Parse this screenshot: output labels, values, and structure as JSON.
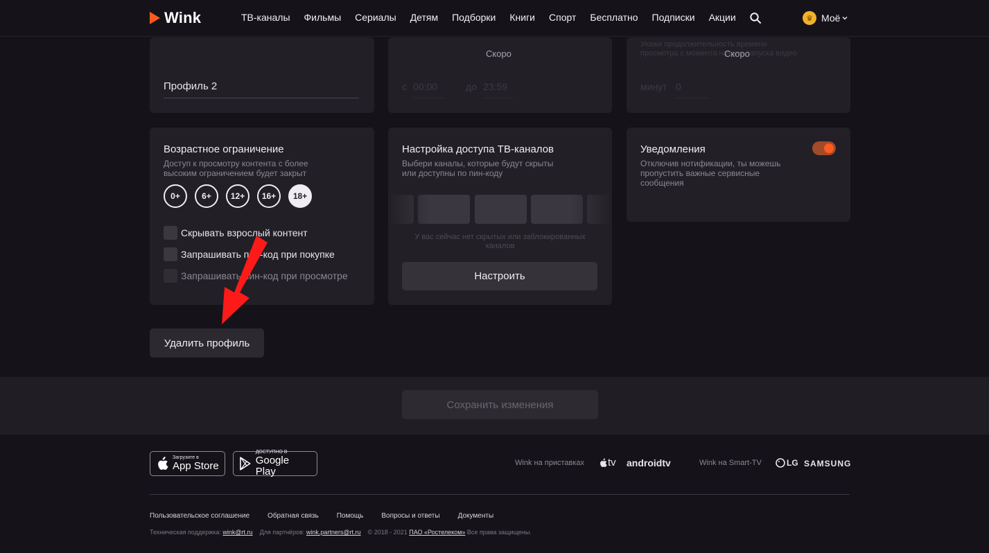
{
  "header": {
    "logo": "Wink",
    "nav": [
      "ТВ-каналы",
      "Фильмы",
      "Сериалы",
      "Детям",
      "Подборки",
      "Книги",
      "Спорт",
      "Бесплатно",
      "Подписки",
      "Акции"
    ],
    "profile_label": "Моё"
  },
  "top_cards": {
    "profile_name": "Профиль 2",
    "time_soon": "Скоро",
    "time_from_prefix": "с",
    "time_from": "00:00",
    "time_to_prefix": "до",
    "time_to": "23:59",
    "limit_desc": "Укажи продолжительность времени просмотра с момента начала запуска видео",
    "limit_soon": "Скоро",
    "limit_unit": "минут",
    "limit_value": "0"
  },
  "age_card": {
    "title": "Возрастное ограничение",
    "desc": "Доступ к просмотру контента с более высоким ограничением будет закрыт",
    "ages": [
      "0+",
      "6+",
      "12+",
      "16+",
      "18+"
    ],
    "selected": "18+",
    "options": [
      "Скрывать взрослый контент",
      "Запрашивать пин-код при покупке",
      "Запрашивать пин-код при просмотре"
    ]
  },
  "channels_card": {
    "title": "Настройка доступа ТВ-каналов",
    "desc": "Выбери каналы, которые будут скрыты или доступны по пин-коду",
    "empty_text": "У вас сейчас нет скрытых или заблокированных каналов",
    "button": "Настроить"
  },
  "notify_card": {
    "title": "Уведомления",
    "desc": "Отключив нотификации, ты можешь пропустить важные сервисные сообщения",
    "toggle_on": true
  },
  "delete_button": "Удалить профиль",
  "save_button": "Сохранить изменения",
  "colors": {
    "accent": "#ff5b1c",
    "bg": "#151319",
    "card": "#221f26"
  },
  "footer": {
    "app_store_small": "Загрузите в",
    "app_store_big": "App Store",
    "google_small": "ДОСТУПНО В",
    "google_big": "Google Play",
    "boxes_note": "Wink на приставках",
    "apple_tv": "tv",
    "android_tv": "androidtv",
    "smart_tv_note": "Wink на Smart-TV",
    "lg": "LG",
    "samsung": "SAMSUNG",
    "links": [
      "Пользовательское соглашение",
      "Обратная связь",
      "Помощь",
      "Вопросы и ответы",
      "Документы"
    ],
    "support_label": "Техническая поддержка:",
    "support_email": "wink@rt.ru",
    "partners_label": "Для партнёров:",
    "partners_email": "wink.partners@rt.ru",
    "copyright": "© 2018 - 2021",
    "company": "ПАО «Ростелеком»",
    "rights": "Все права защищены."
  }
}
